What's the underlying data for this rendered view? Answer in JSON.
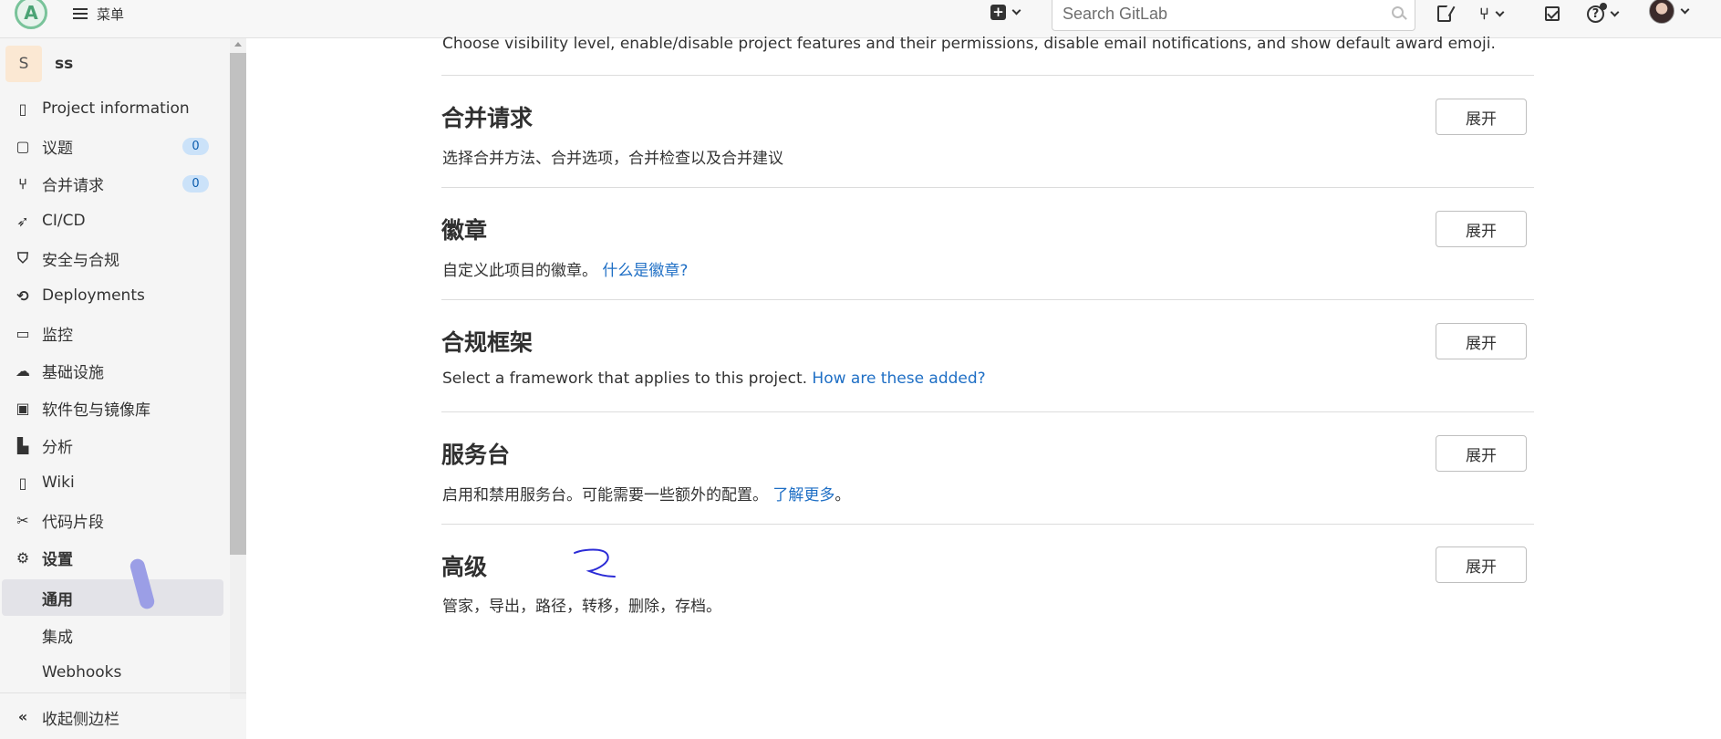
{
  "topbar": {
    "menu_label": "菜单",
    "search_placeholder": "Search GitLab"
  },
  "project": {
    "avatar_letter": "S",
    "name": "ss"
  },
  "sidebar": {
    "items": [
      {
        "label": "Project information",
        "icon": "project-info-icon"
      },
      {
        "label": "议题",
        "icon": "issues-icon",
        "badge": "0"
      },
      {
        "label": "合并请求",
        "icon": "merge-request-icon",
        "badge": "0"
      },
      {
        "label": "CI/CD",
        "icon": "rocket-icon"
      },
      {
        "label": "安全与合规",
        "icon": "shield-icon"
      },
      {
        "label": "Deployments",
        "icon": "deployments-icon"
      },
      {
        "label": "监控",
        "icon": "monitor-icon"
      },
      {
        "label": "基础设施",
        "icon": "cloud-icon"
      },
      {
        "label": "软件包与镜像库",
        "icon": "package-icon"
      },
      {
        "label": "分析",
        "icon": "chart-icon"
      },
      {
        "label": "Wiki",
        "icon": "book-icon"
      },
      {
        "label": "代码片段",
        "icon": "snippet-icon"
      },
      {
        "label": "设置",
        "icon": "settings-icon"
      }
    ],
    "sub_items": [
      {
        "label": "通用",
        "active": true
      },
      {
        "label": "集成"
      },
      {
        "label": "Webhooks"
      }
    ],
    "collapse_label": "收起侧边栏"
  },
  "main": {
    "intro": "Choose visibility level, enable/disable project features and their permissions, disable email notifications, and show default award emoji.",
    "sections": [
      {
        "title": "合并请求",
        "desc": "选择合并方法、合并选项，合并检查以及合并建议",
        "button": "展开"
      },
      {
        "title": "徽章",
        "desc": "自定义此项目的徽章。",
        "link": "什么是徽章?",
        "button": "展开"
      },
      {
        "title": "合规框架",
        "desc": "Select a framework that applies to this project. ",
        "link": "How are these added?",
        "button": "展开"
      },
      {
        "title": "服务台",
        "desc": "启用和禁用服务台。可能需要一些额外的配置。",
        "link": "了解更多",
        "suffix": "。",
        "button": "展开"
      },
      {
        "title": "高级",
        "desc": "管家，导出，路径，转移，删除，存档。",
        "button": "展开"
      }
    ]
  }
}
